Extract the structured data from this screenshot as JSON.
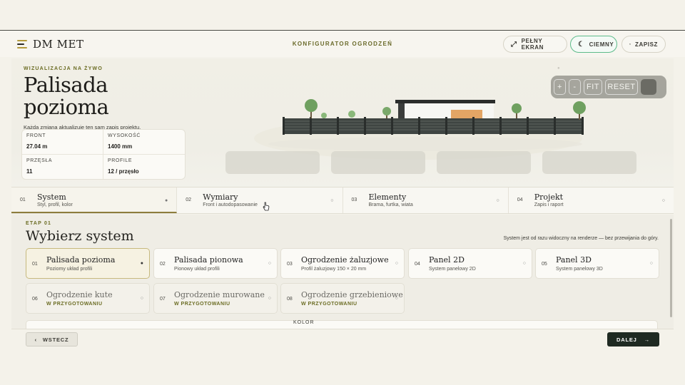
{
  "header": {
    "logo": "DM MET",
    "title": "KONFIGURATOR OGRODZEŃ",
    "buttons": {
      "fullscreen": "PEŁNY EKRAN",
      "dark": "CIEMNY",
      "save": "ZAPISZ"
    }
  },
  "hero": {
    "live_label": "WIZUALIZACJA NA ŻYWO",
    "title_line1": "Palisada",
    "title_line2": "pozioma",
    "subtitle": "Każda zmiana aktualizuje ten sam zapis projektu.",
    "stats": [
      {
        "label": "FRONT",
        "value": "27.04 m"
      },
      {
        "label": "WYSOKOŚĆ",
        "value": "1400 mm"
      },
      {
        "label": "PRZĘSŁA",
        "value": "11"
      },
      {
        "label": "PROFILE",
        "value": "12 / przęsło"
      }
    ]
  },
  "viewer": {
    "zoom_in": "+",
    "zoom_out": "-",
    "fit": "FIT",
    "reset": "RESET"
  },
  "steps": [
    {
      "num": "01",
      "name": "System",
      "sub": "Styl, profil, kolor",
      "mark": "●"
    },
    {
      "num": "02",
      "name": "Wymiary",
      "sub": "Front i autodopasowanie",
      "mark": "○"
    },
    {
      "num": "03",
      "name": "Elementy",
      "sub": "Brama, furtka, wiata",
      "mark": "○"
    },
    {
      "num": "04",
      "name": "Projekt",
      "sub": "Zapis i raport",
      "mark": "○"
    }
  ],
  "system": {
    "stage": "ETAP 01",
    "heading": "Wybierz system",
    "note": "System jest od razu widoczny na renderze — bez przewijania do góry.",
    "options": [
      {
        "num": "01",
        "title": "Palisada pozioma",
        "sub": "Poziomy układ profili",
        "mark": "●"
      },
      {
        "num": "02",
        "title": "Palisada pionowa",
        "sub": "Pionowy układ profili",
        "mark": "○"
      },
      {
        "num": "03",
        "title": "Ogrodzenie żaluzjowe",
        "sub": "Profil żaluzjowy 150 × 20 mm",
        "mark": "○"
      },
      {
        "num": "04",
        "title": "Panel 2D",
        "sub": "System panelowy 2D",
        "mark": "○"
      },
      {
        "num": "05",
        "title": "Panel 3D",
        "sub": "System panelowy 3D",
        "mark": "○"
      },
      {
        "num": "06",
        "title": "Ogrodzenie kute",
        "sub": "W PRZYGOTOWANIU",
        "mark": "○"
      },
      {
        "num": "07",
        "title": "Ogrodzenie murowane",
        "sub": "W PRZYGOTOWANIU",
        "mark": "○"
      },
      {
        "num": "08",
        "title": "Ogrodzenie grzebieniowe",
        "sub": "W PRZYGOTOWANIU",
        "mark": "○"
      }
    ],
    "color_label": "KOLOR"
  },
  "footer": {
    "back": "WSTECZ",
    "next": "DALEJ"
  }
}
